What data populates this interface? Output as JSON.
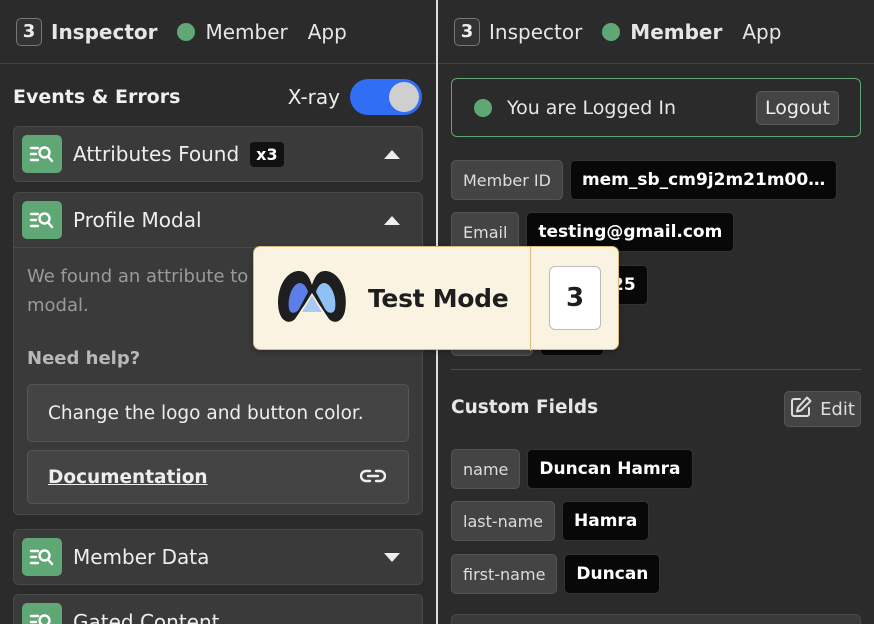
{
  "left_nav": {
    "badge": "3",
    "inspector": "Inspector",
    "member": "Member",
    "app": "App"
  },
  "right_nav": {
    "badge": "3",
    "inspector": "Inspector",
    "member": "Member",
    "app": "App"
  },
  "events": {
    "title": "Events & Errors",
    "xray_label": "X-ray",
    "xray_on": true,
    "cards": [
      {
        "title": "Attributes Found",
        "badge": "x3",
        "expanded": false
      },
      {
        "title": "Profile Modal",
        "expanded": true,
        "body": "We found an attribute to build profile modal.",
        "help_title": "Need help?",
        "help_item": "Change the logo and button color.",
        "doc_link": "Documentation"
      },
      {
        "title": "Member Data",
        "expanded": false
      },
      {
        "title": "Gated Content",
        "expanded": false
      }
    ]
  },
  "member": {
    "status": "You are Logged In",
    "logout": "Logout",
    "fields": [
      {
        "key": "Member ID",
        "value": "mem_sb_cm9j2m21m00…"
      },
      {
        "key": "Email",
        "value": "testing@gmail.com"
      },
      {
        "key": "",
        "value": "r 15, 2025"
      },
      {
        "key": "",
        "value": ""
      }
    ],
    "custom_fields_title": "Custom Fields",
    "edit_label": "Edit",
    "custom_fields": [
      {
        "key": "name",
        "value": "Duncan Hamra"
      },
      {
        "key": "last-name",
        "value": "Hamra"
      },
      {
        "key": "first-name",
        "value": "Duncan"
      }
    ]
  },
  "test_mode": {
    "label": "Test Mode",
    "count": "3"
  },
  "colors": {
    "accent_green": "#5fa876",
    "toggle_blue": "#2f6ef5",
    "test_mode_bg": "#fbf3e2"
  }
}
